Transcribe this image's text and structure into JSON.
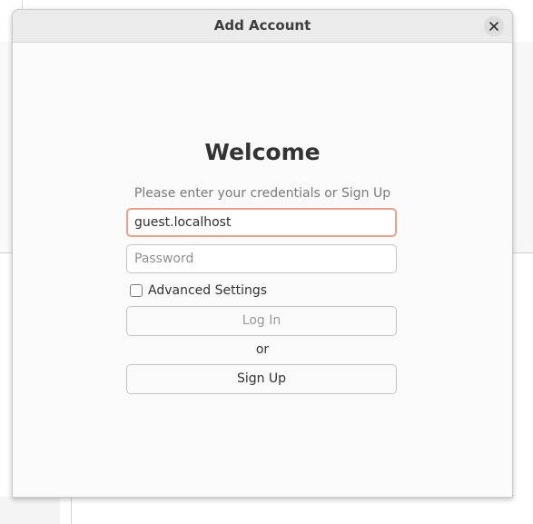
{
  "dialog": {
    "title": "Add Account",
    "close_icon": "close-icon"
  },
  "login": {
    "heading": "Welcome",
    "subtitle": "Please enter your credentials or Sign Up",
    "username_value": "guest.localhost",
    "password_placeholder": "Password",
    "advanced_settings_label": "Advanced Settings",
    "advanced_settings_checked": false,
    "login_button": "Log In",
    "or_text": "or",
    "signup_button": "Sign Up"
  },
  "colors": {
    "focus_border": "#e8a28a",
    "disabled_text": "#9a9a9a"
  }
}
